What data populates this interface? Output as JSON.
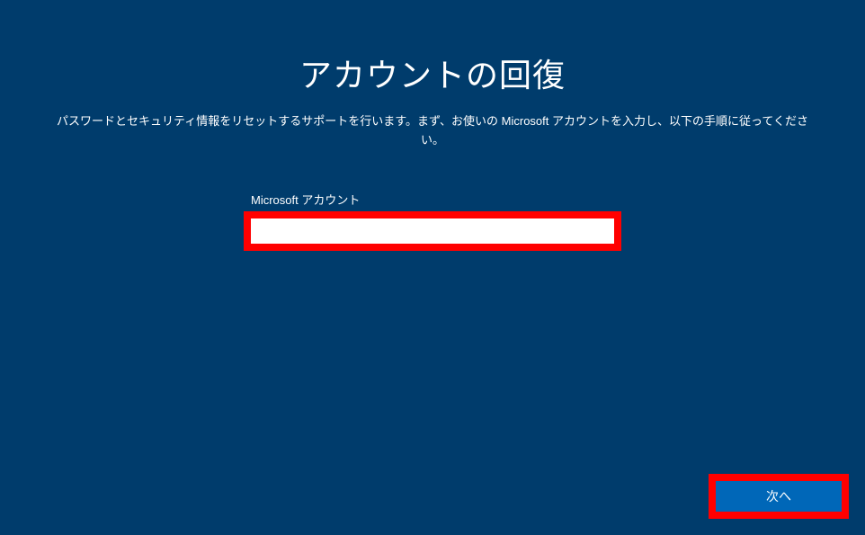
{
  "page": {
    "title": "アカウントの回復",
    "subtitle": "パスワードとセキュリティ情報をリセットするサポートを行います。まず、お使いの Microsoft アカウントを入力し、以下の手順に従ってください。"
  },
  "form": {
    "account_label": "Microsoft アカウント",
    "account_value": ""
  },
  "buttons": {
    "next_label": "次へ"
  },
  "colors": {
    "background": "#003c6c",
    "highlight": "#ff0000",
    "button_bg": "#0067b8",
    "text": "#ffffff"
  }
}
